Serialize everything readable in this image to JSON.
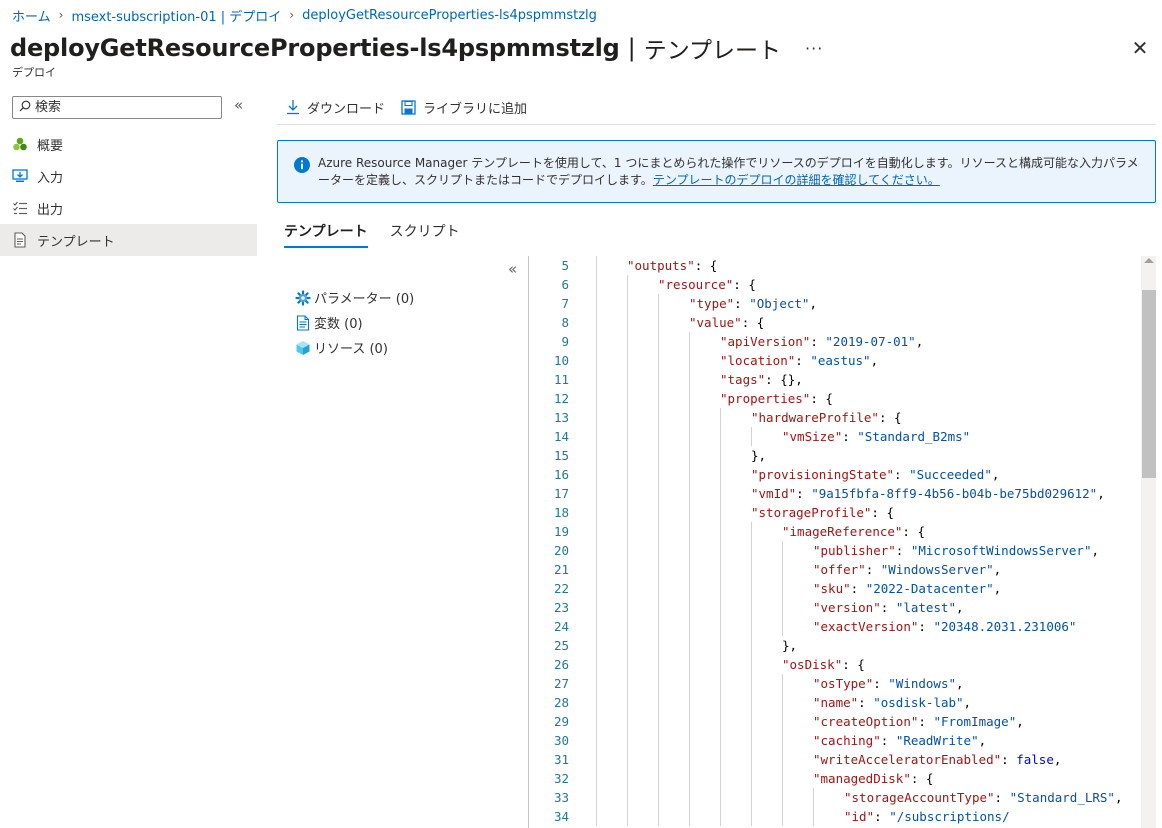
{
  "breadcrumb": [
    "ホーム",
    "msext-subscription-01 | デプロイ",
    "deployGetResourceProperties-ls4pspmmstzlg"
  ],
  "header": {
    "title": "deployGetResourceProperties-ls4pspmmstzlg",
    "separator": "|",
    "section": "テンプレート",
    "subtitle": "デプロイ",
    "more": "···",
    "close": "✕"
  },
  "search": {
    "placeholder": "検索"
  },
  "collapse_glyph": "«",
  "nav": {
    "items": [
      {
        "label": "概要",
        "icon": "overview-icon"
      },
      {
        "label": "入力",
        "icon": "inputs-icon"
      },
      {
        "label": "出力",
        "icon": "outputs-icon"
      },
      {
        "label": "テンプレート",
        "icon": "template-icon",
        "active": true
      }
    ]
  },
  "toolbar": {
    "download": "ダウンロード",
    "add_to_library": "ライブラリに追加"
  },
  "info": {
    "text": "Azure Resource Manager テンプレートを使用して、1 つにまとめられた操作でリソースのデプロイを自動化します。リソースと構成可能な入力パラメーターを定義し、スクリプトまたはコードでデプロイします。",
    "link": "テンプレートのデプロイの詳細を確認してください。"
  },
  "tabs": [
    {
      "label": "テンプレート",
      "active": true
    },
    {
      "label": "スクリプト",
      "active": false
    }
  ],
  "tree": [
    {
      "label": "パラメーター (0)",
      "icon": "parameters-icon"
    },
    {
      "label": "変数 (0)",
      "icon": "variables-icon"
    },
    {
      "label": "リソース (0)",
      "icon": "resources-icon"
    }
  ],
  "code": {
    "lines": [
      {
        "n": "5",
        "indent": 1,
        "key": "outputs",
        "tail": ": {"
      },
      {
        "n": "6",
        "indent": 2,
        "key": "resource",
        "tail": ": {"
      },
      {
        "n": "7",
        "indent": 3,
        "key": "type",
        "value": "\"Object\"",
        "tail": ","
      },
      {
        "n": "8",
        "indent": 3,
        "key": "value",
        "tail": ": {"
      },
      {
        "n": "9",
        "indent": 4,
        "key": "apiVersion",
        "value": "\"2019-07-01\"",
        "tail": ","
      },
      {
        "n": "10",
        "indent": 4,
        "key": "location",
        "value": "\"eastus\"",
        "tail": ","
      },
      {
        "n": "11",
        "indent": 4,
        "key": "tags",
        "tail": ": {},"
      },
      {
        "n": "12",
        "indent": 4,
        "key": "properties",
        "tail": ": {"
      },
      {
        "n": "13",
        "indent": 5,
        "key": "hardwareProfile",
        "tail": ": {"
      },
      {
        "n": "14",
        "indent": 6,
        "key": "vmSize",
        "value": "\"Standard_B2ms\"",
        "tail": ""
      },
      {
        "n": "15",
        "indent": 5,
        "raw": "},"
      },
      {
        "n": "16",
        "indent": 5,
        "key": "provisioningState",
        "value": "\"Succeeded\"",
        "tail": ","
      },
      {
        "n": "17",
        "indent": 5,
        "key": "vmId",
        "value": "\"9a15fbfa-8ff9-4b56-b04b-be75bd029612\"",
        "tail": ","
      },
      {
        "n": "18",
        "indent": 5,
        "key": "storageProfile",
        "tail": ": {"
      },
      {
        "n": "19",
        "indent": 6,
        "key": "imageReference",
        "tail": ": {"
      },
      {
        "n": "20",
        "indent": 7,
        "key": "publisher",
        "value": "\"MicrosoftWindowsServer\"",
        "tail": ","
      },
      {
        "n": "21",
        "indent": 7,
        "key": "offer",
        "value": "\"WindowsServer\"",
        "tail": ","
      },
      {
        "n": "22",
        "indent": 7,
        "key": "sku",
        "value": "\"2022-Datacenter\"",
        "tail": ","
      },
      {
        "n": "23",
        "indent": 7,
        "key": "version",
        "value": "\"latest\"",
        "tail": ","
      },
      {
        "n": "24",
        "indent": 7,
        "key": "exactVersion",
        "value": "\"20348.2031.231006\"",
        "tail": ""
      },
      {
        "n": "25",
        "indent": 6,
        "raw": "},"
      },
      {
        "n": "26",
        "indent": 6,
        "key": "osDisk",
        "tail": ": {"
      },
      {
        "n": "27",
        "indent": 7,
        "key": "osType",
        "value": "\"Windows\"",
        "tail": ","
      },
      {
        "n": "28",
        "indent": 7,
        "key": "name",
        "value": "\"osdisk-lab\"",
        "tail": ","
      },
      {
        "n": "29",
        "indent": 7,
        "key": "createOption",
        "value": "\"FromImage\"",
        "tail": ","
      },
      {
        "n": "30",
        "indent": 7,
        "key": "caching",
        "value": "\"ReadWrite\"",
        "tail": ","
      },
      {
        "n": "31",
        "indent": 7,
        "key": "writeAcceleratorEnabled",
        "value": "false",
        "tail": ",",
        "kw": true
      },
      {
        "n": "32",
        "indent": 7,
        "key": "managedDisk",
        "tail": ": {"
      },
      {
        "n": "33",
        "indent": 8,
        "key": "storageAccountType",
        "value": "\"Standard_LRS\"",
        "tail": ","
      },
      {
        "n": "34",
        "indent": 8,
        "key": "id",
        "value": "\"/subscriptions/",
        "tail": ""
      }
    ]
  }
}
